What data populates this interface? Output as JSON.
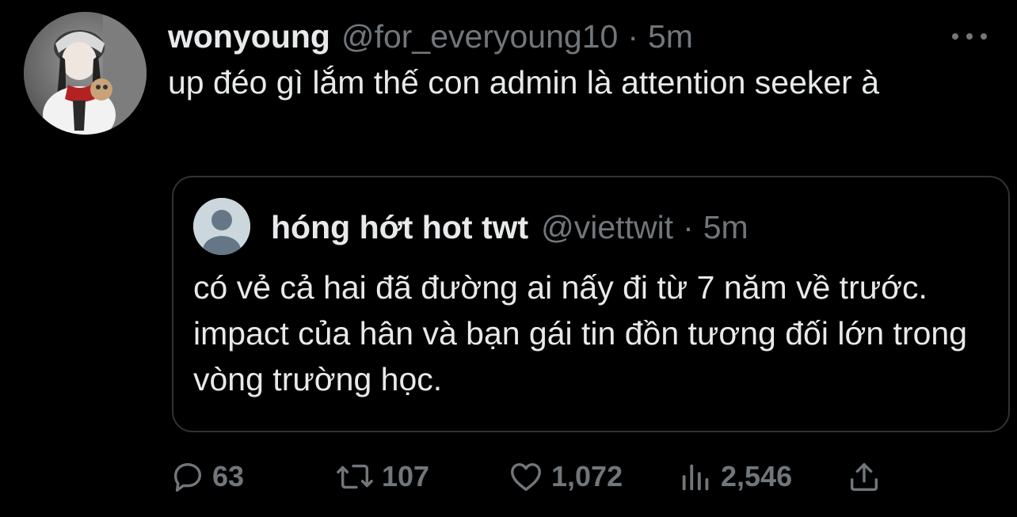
{
  "tweet": {
    "display_name": "wonyoung",
    "handle": "@for_everyoung10",
    "separator": "·",
    "time": "5m",
    "text": "up đéo gì lắm thế con admin là attention seeker à",
    "more_icon": "more-horizontal-icon"
  },
  "quote": {
    "display_name": "hóng hớt hot twt",
    "handle": "@viettwit",
    "separator": "·",
    "time": "5m",
    "text": "có vẻ cả hai đã đường ai nấy đi từ 7 năm về trước. impact của hân và bạn gái tin đồn tương đối lớn trong vòng trường học."
  },
  "actions": {
    "replies": "63",
    "retweets": "107",
    "likes": "1,072",
    "views": "2,546"
  },
  "colors": {
    "background": "#000000",
    "text": "#e7e9ea",
    "secondary": "#71767b",
    "border": "#2f3336"
  }
}
